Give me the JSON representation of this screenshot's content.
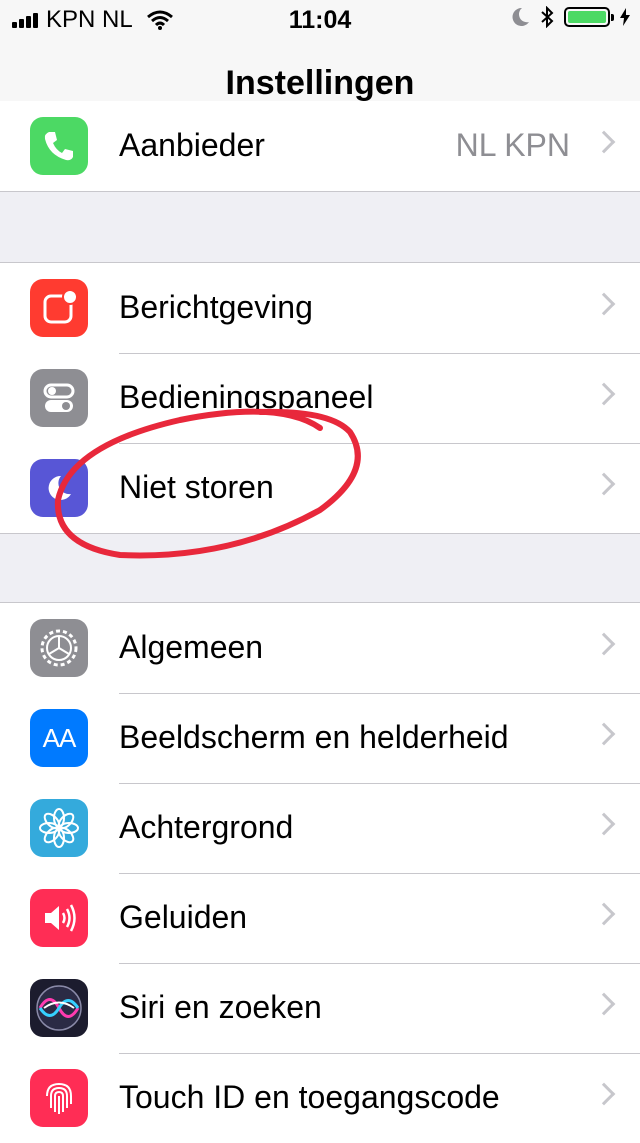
{
  "status_bar": {
    "carrier": "KPN NL",
    "time": "11:04",
    "battery_level": 1.0,
    "battery_color": "#4cd964"
  },
  "nav": {
    "title": "Instellingen"
  },
  "rows": {
    "aanbieder": {
      "label": "Aanbieder",
      "detail": "NL KPN",
      "icon": "phone-icon",
      "color": "#4cd964"
    },
    "berichtgeving": {
      "label": "Berichtgeving",
      "icon": "notifications-icon",
      "color": "#ff3b30"
    },
    "bedieningspaneel": {
      "label": "Bedieningspaneel",
      "icon": "control-center-icon",
      "color": "#8e8e93"
    },
    "niet_storen": {
      "label": "Niet storen",
      "icon": "moon-icon",
      "color": "#5856d6"
    },
    "algemeen": {
      "label": "Algemeen",
      "icon": "gear-icon",
      "color": "#8e8e93"
    },
    "beeldscherm": {
      "label": "Beeldscherm en helderheid",
      "icon": "text-size-icon",
      "color": "#007aff"
    },
    "achtergrond": {
      "label": "Achtergrond",
      "icon": "flower-icon",
      "color": "#34aadc"
    },
    "geluiden": {
      "label": "Geluiden",
      "icon": "speaker-icon",
      "color": "#ff2d55"
    },
    "siri": {
      "label": "Siri en zoeken",
      "icon": "siri-icon",
      "color": "#1c1c2e"
    },
    "touch_id": {
      "label": "Touch ID en toegangscode",
      "icon": "fingerprint-icon",
      "color": "#ff2d55"
    }
  },
  "icon_text": {
    "text_size": "AA"
  },
  "annotation_color": "#e8283b"
}
